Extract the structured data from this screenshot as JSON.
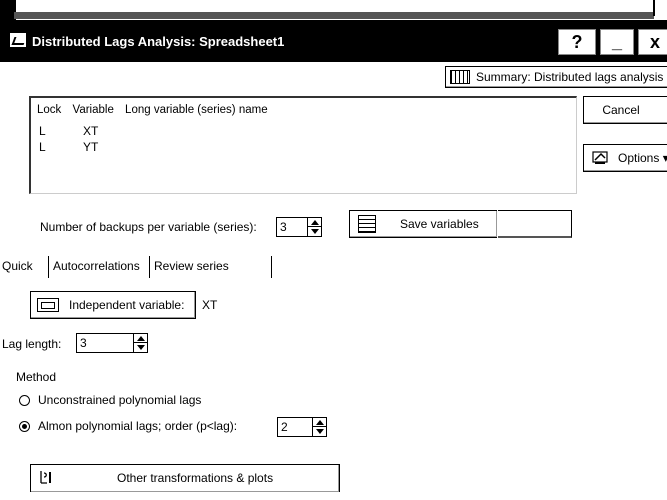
{
  "window": {
    "title": "Distributed Lags Analysis: Spreadsheet1",
    "help_label": "?",
    "minimize_label": "_",
    "close_label": "x"
  },
  "summary_button": {
    "label": "Summary:  Distributed lags analysis"
  },
  "cancel_button": {
    "label": "Cancel"
  },
  "options_button": {
    "label": "Options ▾"
  },
  "variable_list": {
    "headers": [
      "Lock",
      "Variable",
      "Long variable (series) name"
    ],
    "rows": [
      {
        "lock": "L",
        "variable": "XT"
      },
      {
        "lock": "L",
        "variable": "YT"
      }
    ]
  },
  "backups": {
    "label": "Number of backups per variable (series):",
    "value": "3"
  },
  "save_variables_button": {
    "label": "Save variables"
  },
  "tabs": [
    {
      "label": "Quick"
    },
    {
      "label": "Autocorrelations"
    },
    {
      "label": "Review series"
    }
  ],
  "independent_variable": {
    "button_label": "Independent variable:",
    "value": "XT"
  },
  "lag_length": {
    "label": "Lag length:",
    "value": "3"
  },
  "method": {
    "label": "Method",
    "option_unconstrained": "Unconstrained polynomial lags",
    "option_almon": "Almon polynomial lags; order (p<lag):",
    "almon_order": "2",
    "selected": "almon"
  },
  "other_transformations_button": {
    "label": "Other transformations & plots"
  }
}
